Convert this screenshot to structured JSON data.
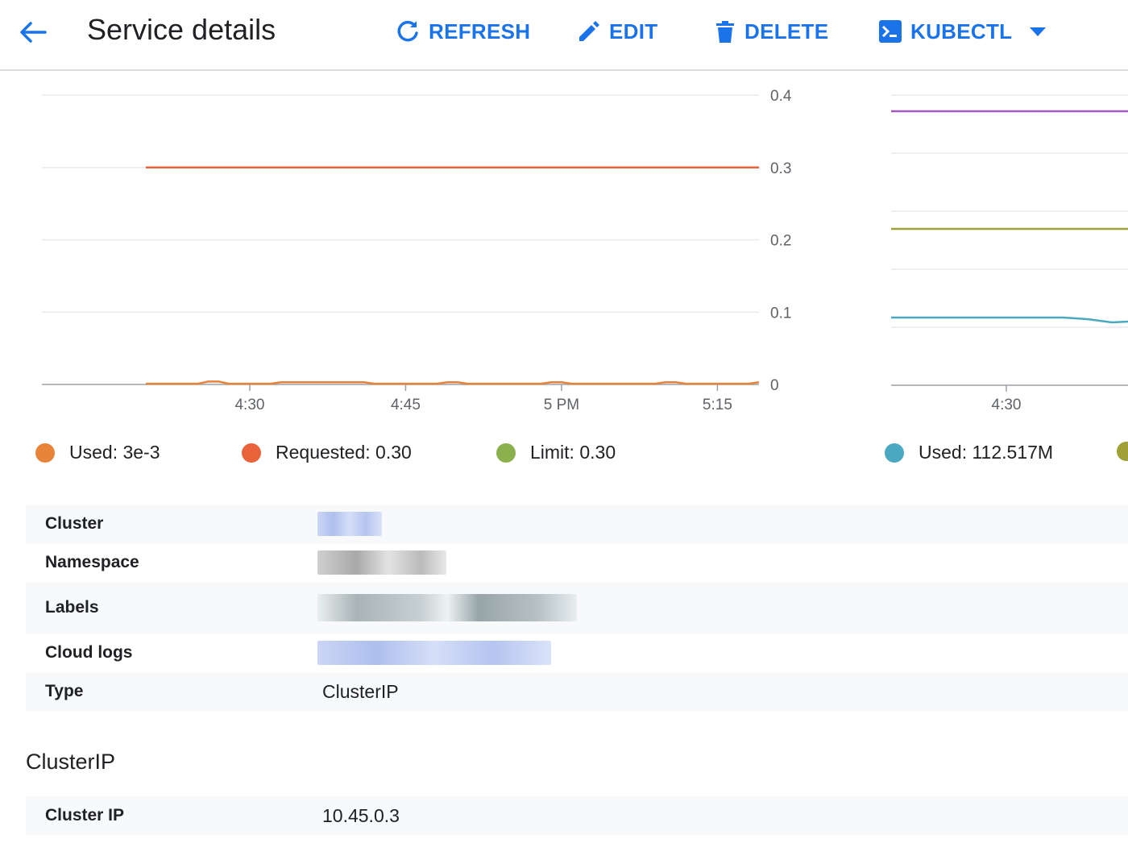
{
  "header": {
    "title": "Service details",
    "actions": {
      "refresh": "REFRESH",
      "edit": "EDIT",
      "delete": "DELETE",
      "kubectl": "KUBECTL"
    }
  },
  "colors": {
    "accent": "#1a73e8",
    "used_cpu": "#e8833a",
    "requested": "#e8633a",
    "limit": "#8bb04e",
    "used_memory": "#4aa8c0",
    "limit_memory": "#a0a038",
    "requested_memory": "#a35ac0"
  },
  "legend": {
    "cpu_used": "Used: 3e-3",
    "cpu_requested": "Requested: 0.30",
    "cpu_limit": "Limit: 0.30",
    "mem_used": "Used: 112.517M"
  },
  "chart_data": [
    {
      "type": "line",
      "title": "",
      "x_ticks": [
        "4:30",
        "4:45",
        "5 PM",
        "5:15"
      ],
      "y_ticks": [
        "0",
        "0.1",
        "0.2",
        "0.3",
        "0.4"
      ],
      "ylim": [
        0,
        0.4
      ],
      "grid": true,
      "legend_placement": "bottom",
      "series": [
        {
          "name": "Used: 3e-3",
          "color": "#e8833a",
          "x": [
            "4:20",
            "4:25",
            "4:26",
            "4:27",
            "4:28",
            "4:32",
            "4:33",
            "4:41",
            "4:42",
            "4:48",
            "4:49",
            "4:50",
            "4:51",
            "4:58",
            "4:59",
            "5:00",
            "5:01",
            "5:09",
            "5:10",
            "5:11",
            "5:12",
            "5:18",
            "5:19"
          ],
          "values": [
            0.001,
            0.001,
            0.004,
            0.004,
            0.001,
            0.001,
            0.003,
            0.003,
            0.001,
            0.001,
            0.003,
            0.003,
            0.001,
            0.001,
            0.003,
            0.003,
            0.001,
            0.001,
            0.003,
            0.003,
            0.001,
            0.001,
            0.003
          ]
        },
        {
          "name": "Requested: 0.30",
          "color": "#e8633a",
          "x": [
            "4:20",
            "5:19"
          ],
          "values": [
            0.3,
            0.3
          ]
        },
        {
          "name": "Limit: 0.30",
          "color": "#8bb04e",
          "x": [
            "4:20",
            "5:19"
          ],
          "values": [
            0.3,
            0.3
          ]
        }
      ]
    },
    {
      "type": "line",
      "title": "",
      "x_ticks": [
        "4:30"
      ],
      "grid": true,
      "legend_placement": "bottom",
      "series": [
        {
          "name": "Used: 112.517M",
          "color": "#4aa8c0"
        },
        {
          "color": "#a0a038"
        },
        {
          "color": "#a35ac0"
        }
      ]
    }
  ],
  "details": {
    "rows": [
      {
        "key": "Cluster"
      },
      {
        "key": "Namespace"
      },
      {
        "key": "Labels"
      },
      {
        "key": "Cloud logs"
      },
      {
        "key": "Type",
        "value": "ClusterIP"
      }
    ]
  },
  "clusterip_section": {
    "title": "ClusterIP",
    "key": "Cluster IP",
    "value": "10.45.0.3"
  }
}
